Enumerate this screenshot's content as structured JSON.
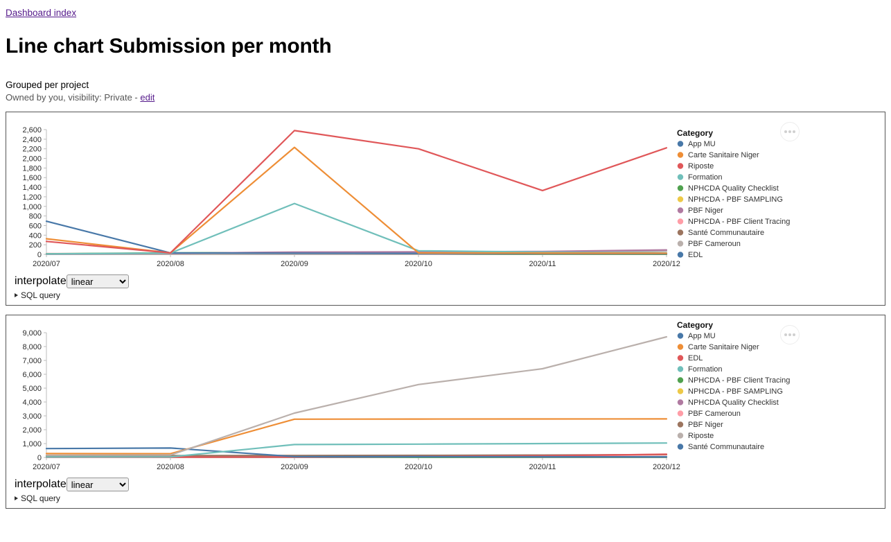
{
  "breadcrumb": {
    "label": "Dashboard index"
  },
  "header": {
    "title": "Line chart Submission per month",
    "subtitle": "Grouped per project",
    "meta_prefix": "Owned by you, visibility: Private - ",
    "meta_edit_label": "edit"
  },
  "controls": {
    "interpolate_label": "interpolate",
    "interpolate_value": "linear",
    "interpolate_options": [
      "linear"
    ],
    "sql_query_label": "SQL query"
  },
  "menu": {
    "dots_label": "…"
  },
  "palette": {
    "blue": "#4878a8",
    "orange": "#ee8e36",
    "red": "#e05759",
    "teal": "#70bfba",
    "green": "#50a14f",
    "yellow": "#edc948",
    "purple": "#b07aa1",
    "pink": "#ff9da7",
    "brown": "#9c755f",
    "gray": "#bab0ac"
  },
  "chart_data": [
    {
      "type": "line",
      "title": "",
      "xlabel": "",
      "ylabel": "",
      "categories": [
        "2020/07",
        "2020/08",
        "2020/09",
        "2020/10",
        "2020/11",
        "2020/12"
      ],
      "ylim": [
        0,
        2600
      ],
      "yticks": [
        0,
        200,
        400,
        600,
        800,
        1000,
        1200,
        1400,
        1600,
        1800,
        2000,
        2200,
        2400,
        2600
      ],
      "ytick_labels": [
        "0",
        "200",
        "400",
        "600",
        "800",
        "1,000",
        "1,200",
        "1,400",
        "1,600",
        "1,800",
        "2,000",
        "2,200",
        "2,400",
        "2,600"
      ],
      "grid": false,
      "legend_title": "Category",
      "legend_position": "right",
      "series": [
        {
          "name": "App MU",
          "color": "#4878a8",
          "values": [
            690,
            30,
            25,
            20,
            18,
            15
          ]
        },
        {
          "name": "Carte Sanitaire Niger",
          "color": "#ee8e36",
          "values": [
            325,
            30,
            2230,
            30,
            28,
            25
          ]
        },
        {
          "name": "Riposte",
          "color": "#e05759",
          "values": [
            270,
            30,
            2580,
            2200,
            1330,
            2220
          ]
        },
        {
          "name": "Formation",
          "color": "#70bfba",
          "values": [
            8,
            28,
            1060,
            75,
            48,
            30
          ]
        },
        {
          "name": "NPHCDA Quality Checklist",
          "color": "#50a14f",
          "values": [
            12,
            30,
            38,
            10,
            8,
            6
          ]
        },
        {
          "name": "NPHCDA - PBF SAMPLING",
          "color": "#edc948",
          "values": [
            4,
            6,
            8,
            6,
            5,
            5
          ]
        },
        {
          "name": "PBF Niger",
          "color": "#b07aa1",
          "values": [
            6,
            22,
            48,
            52,
            60,
            92
          ]
        },
        {
          "name": "NPHCDA - PBF Client Tracing",
          "color": "#ff9da7",
          "values": [
            18,
            10,
            6,
            5,
            4,
            4
          ]
        },
        {
          "name": "Santé Communautaire",
          "color": "#9c755f",
          "values": [
            2,
            14,
            16,
            14,
            12,
            10
          ]
        },
        {
          "name": "PBF Cameroun",
          "color": "#bab0ac",
          "values": [
            1,
            2,
            3,
            4,
            30,
            70
          ]
        },
        {
          "name": "EDL",
          "color": "#4878a8",
          "values": [
            1,
            1,
            2,
            2,
            3,
            3
          ]
        }
      ]
    },
    {
      "type": "line",
      "title": "",
      "xlabel": "",
      "ylabel": "",
      "categories": [
        "2020/07",
        "2020/08",
        "2020/09",
        "2020/10",
        "2020/11",
        "2020/12"
      ],
      "ylim": [
        0,
        9000
      ],
      "yticks": [
        0,
        1000,
        2000,
        3000,
        4000,
        5000,
        6000,
        7000,
        8000,
        9000
      ],
      "ytick_labels": [
        "0",
        "1,000",
        "2,000",
        "3,000",
        "4,000",
        "5,000",
        "6,000",
        "7,000",
        "8,000",
        "9,000"
      ],
      "grid": false,
      "legend_title": "Category",
      "legend_position": "right",
      "series": [
        {
          "name": "App MU",
          "color": "#4878a8",
          "values": [
            640,
            680,
            60,
            55,
            50,
            45
          ]
        },
        {
          "name": "Carte Sanitaire Niger",
          "color": "#ee8e36",
          "values": [
            280,
            270,
            2760,
            2770,
            2775,
            2780
          ]
        },
        {
          "name": "EDL",
          "color": "#e05759",
          "values": [
            20,
            25,
            30,
            60,
            120,
            230
          ]
        },
        {
          "name": "Formation",
          "color": "#70bfba",
          "values": [
            30,
            40,
            930,
            960,
            1000,
            1040
          ]
        },
        {
          "name": "NPHCDA - PBF Client Tracing",
          "color": "#50a14f",
          "values": [
            15,
            18,
            22,
            22,
            22,
            22
          ]
        },
        {
          "name": "NPHCDA - PBF SAMPLING",
          "color": "#edc948",
          "values": [
            8,
            10,
            14,
            14,
            14,
            14
          ]
        },
        {
          "name": "NPHCDA Quality Checklist",
          "color": "#b07aa1",
          "values": [
            12,
            30,
            120,
            60,
            45,
            40
          ]
        },
        {
          "name": "PBF Cameroun",
          "color": "#ff9da7",
          "values": [
            5,
            8,
            20,
            55,
            110,
            190
          ]
        },
        {
          "name": "PBF Niger",
          "color": "#9c755f",
          "values": [
            120,
            130,
            140,
            150,
            170,
            205
          ]
        },
        {
          "name": "Riposte",
          "color": "#bab0ac",
          "values": [
            160,
            175,
            3200,
            5260,
            6400,
            8700
          ]
        },
        {
          "name": "Santé Communautaire",
          "color": "#4878a8",
          "values": [
            6,
            8,
            12,
            14,
            16,
            18
          ]
        }
      ]
    }
  ]
}
